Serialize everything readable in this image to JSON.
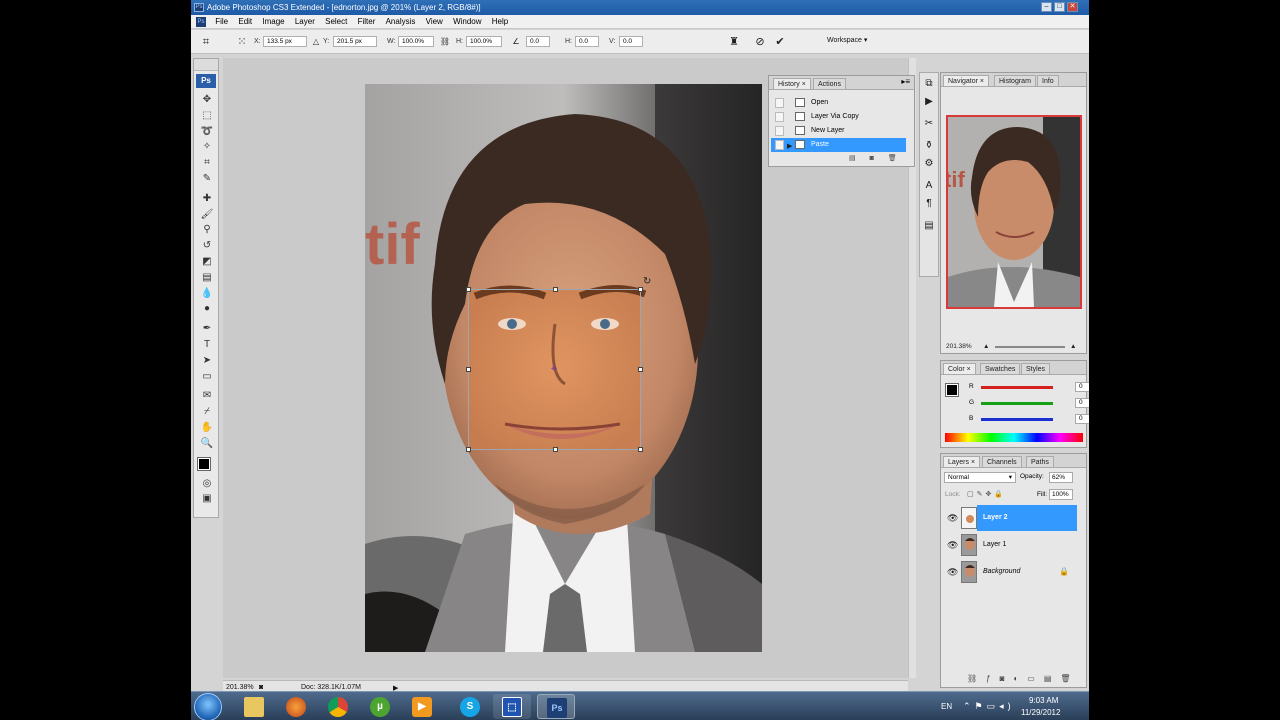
{
  "window": {
    "title": "Adobe Photoshop CS3 Extended - [ednorton.jpg @ 201% (Layer 2, RGB/8#)]"
  },
  "menu": [
    "File",
    "Edit",
    "Image",
    "Layer",
    "Select",
    "Filter",
    "Analysis",
    "View",
    "Window",
    "Help"
  ],
  "options": {
    "x_label": "X:",
    "x_value": "133.5 px",
    "y_label": "Y:",
    "y_value": "201.5 px",
    "w_label": "W:",
    "w_value": "100.0%",
    "h_label": "H:",
    "h_value": "100.0%",
    "rot_value": "0.0",
    "hskew_label": "H:",
    "hskew_value": "0.0",
    "vskew_label": "V:",
    "vskew_value": "0.0",
    "workspace": "Workspace ▾"
  },
  "toolbox": {
    "logo": "Ps"
  },
  "history": {
    "tabs": [
      "History",
      "Actions"
    ],
    "items": [
      {
        "label": "Open",
        "selected": false
      },
      {
        "label": "Layer Via Copy",
        "selected": false
      },
      {
        "label": "New Layer",
        "selected": false
      },
      {
        "label": "Paste",
        "selected": true
      }
    ]
  },
  "navigator": {
    "tabs": [
      "Navigator",
      "Histogram",
      "Info"
    ],
    "zoom": "201.38%"
  },
  "color": {
    "tabs": [
      "Color",
      "Swatches",
      "Styles"
    ],
    "channels": [
      {
        "label": "R",
        "value": "0",
        "color": "#d62020"
      },
      {
        "label": "G",
        "value": "0",
        "color": "#15a015"
      },
      {
        "label": "B",
        "value": "0",
        "color": "#1a2fd0"
      }
    ]
  },
  "layers": {
    "tabs": [
      "Layers",
      "Channels",
      "Paths"
    ],
    "blend_mode": "Normal",
    "opacity_label": "Opacity:",
    "opacity_value": "62%",
    "lock_label": "Lock:",
    "fill_label": "Fill:",
    "fill_value": "100%",
    "items": [
      {
        "name": "Layer 2",
        "selected": true
      },
      {
        "name": "Layer 1",
        "selected": false
      },
      {
        "name": "Background",
        "selected": false
      }
    ]
  },
  "status": {
    "zoom": "201.38%",
    "doc": "Doc: 328.1K/1.07M"
  },
  "taskbar": {
    "language": "EN",
    "time": "9:03 AM",
    "date": "11/29/2012",
    "apps": [
      "Windows Explorer",
      "Firefox",
      "Chrome",
      "uTorrent",
      "Media Player",
      "Skype",
      "App",
      "Photoshop"
    ]
  },
  "colors": {
    "selection": "#3399ff",
    "title_bar": "#1e5aa6",
    "canvas_bg": "#cbcaca"
  }
}
